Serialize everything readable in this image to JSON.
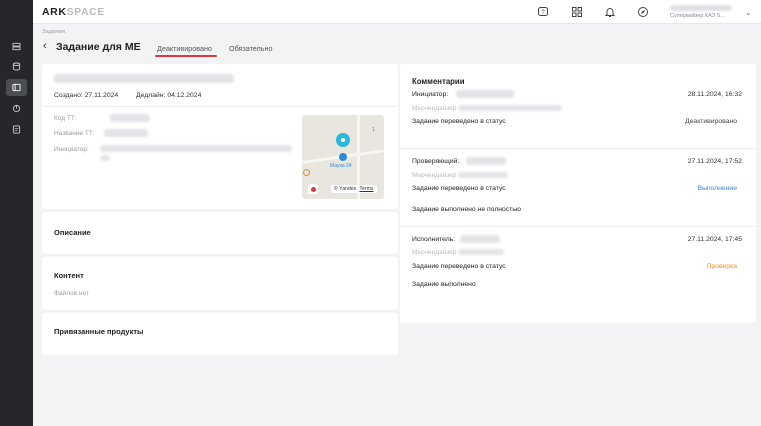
{
  "brand": {
    "logo_part1": "ARK",
    "logo_part2": "SPACE"
  },
  "user": {
    "role_label": "Супервайзер КАЗ S..."
  },
  "breadcrumb": "Задания",
  "page": {
    "title": "Задание для МЕ",
    "tabs": [
      {
        "label": "Деактивировано",
        "active": true
      },
      {
        "label": "Обязательно",
        "active": false
      }
    ]
  },
  "task": {
    "created_label": "Создано:",
    "created_value": "27.11.2024",
    "deadline_label": "Дедлайн:",
    "deadline_value": "04.12.2024",
    "fields": [
      {
        "label": "Код ТТ:"
      },
      {
        "label": "Название ТТ:"
      },
      {
        "label": "Инициатор:"
      }
    ]
  },
  "map": {
    "place_label": "Мауха 24",
    "number": "1",
    "provider": "Yandex",
    "terms": "Terms"
  },
  "sections": {
    "description": "Описание",
    "content": "Контент",
    "content_empty": "Файлов нет",
    "products": "Привязанные продукты"
  },
  "comments": {
    "title": "Комментарии",
    "entries": [
      {
        "role": "Инициатор:",
        "date": "28.11.2024, 16:32",
        "sub": "Мерчендайзер",
        "text": "Задание переведено в статус",
        "status": "Деактивировано",
        "status_color": "#444444",
        "note": ""
      },
      {
        "role": "Проверяющий:",
        "date": "27.11.2024, 17:52",
        "sub": "Мерчендайзер",
        "text": "Задание переведено в статус",
        "status": "Выполнение",
        "status_color": "#3b82e0",
        "note": "Задание выполнено не полностью"
      },
      {
        "role": "Исполнитель:",
        "date": "27.11.2024, 17:45",
        "sub": "Мерчендайзер",
        "text": "Задание переведено в статус",
        "status": "Проверка",
        "status_color": "#f0902e",
        "note": "Задание выполнено"
      }
    ]
  },
  "icons": {
    "sidebar": [
      "layers-icon",
      "database-icon",
      "tasks-icon",
      "chart-icon",
      "reports-icon"
    ],
    "topbar": [
      "help-icon",
      "grid-icon",
      "bell-icon",
      "compass-icon"
    ]
  },
  "colors": {
    "accent": "#e0383e",
    "sidebar": "#25272b"
  }
}
